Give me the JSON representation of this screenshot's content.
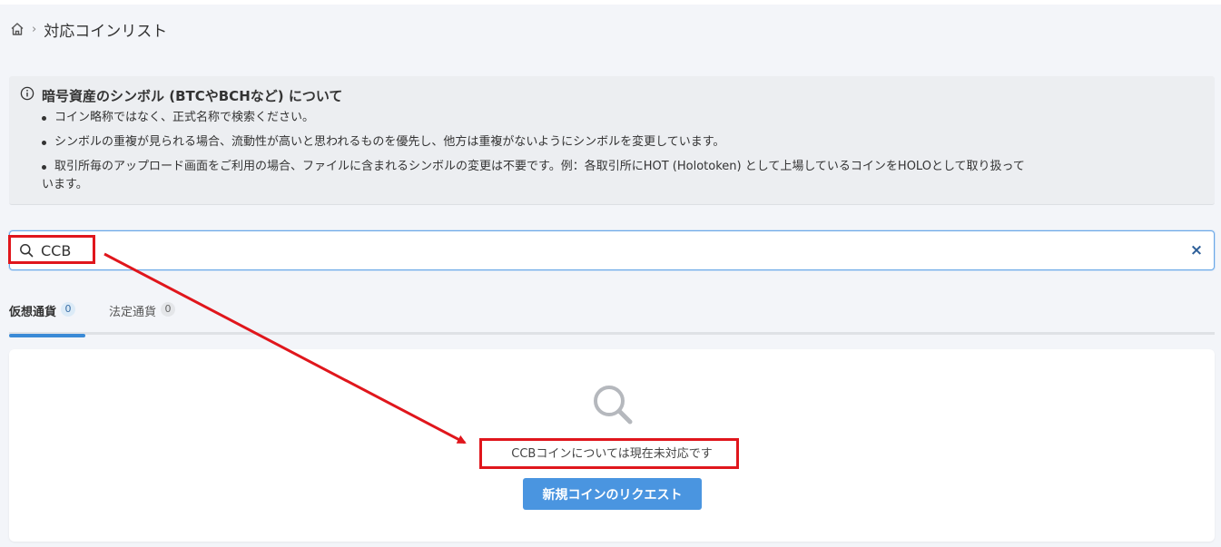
{
  "breadcrumb": {
    "separator": "›",
    "current": "対応コインリスト"
  },
  "info": {
    "title": "暗号資産のシンボル (BTCやBCHなど) について",
    "items": [
      "コイン略称ではなく、正式名称で検索ください。",
      "シンボルの重複が見られる場合、流動性が高いと思われるものを優先し、他方は重複がないようにシンボルを変更しています。",
      "取引所毎のアップロード画面をご利用の場合、ファイルに含まれるシンボルの変更は不要です。例：各取引所にHOT (Holotoken) として上場しているコインをHOLOとして取り扱って"
    ],
    "item3_cont": "います。"
  },
  "search": {
    "value": "CCB",
    "clear": "×"
  },
  "tabs": [
    {
      "label": "仮想通貨",
      "count": "0",
      "active": true
    },
    {
      "label": "法定通貨",
      "count": "0",
      "active": false
    }
  ],
  "result": {
    "message": "CCBコインについては現在未対応です",
    "request_button": "新規コインのリクエスト"
  },
  "colors": {
    "accent": "#4a95e0",
    "annotation": "#e0161c",
    "clear": "#2d5f99"
  },
  "icons": {
    "home": "home-icon",
    "info": "info-icon",
    "search": "search-icon",
    "clear": "close-icon",
    "empty": "search-icon"
  }
}
